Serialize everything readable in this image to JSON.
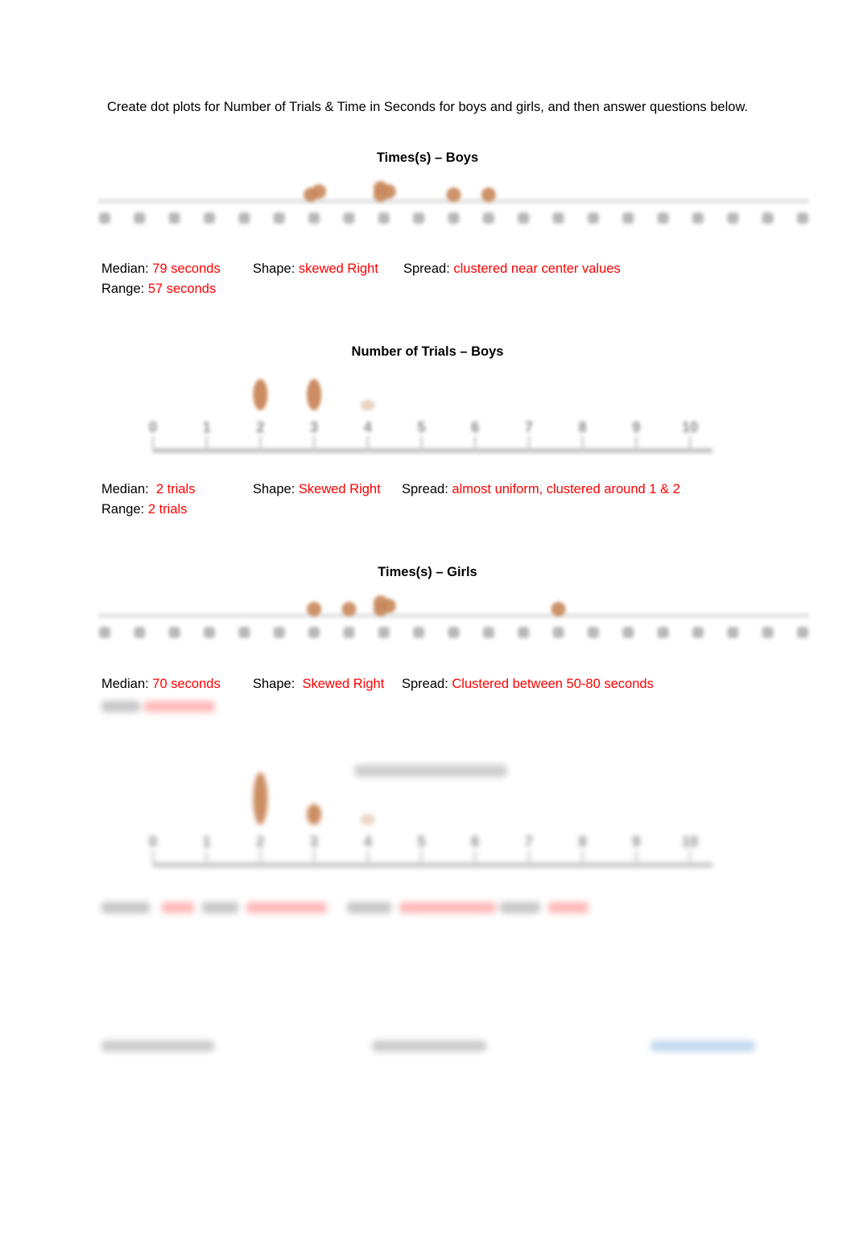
{
  "intro": "Create dot plots for Number of Trials & Time in Seconds for boys and girls, and then answer questions below.",
  "colors": {
    "answer": "#ff0000",
    "dot": "#c8875a",
    "axis": "#bdbdbd"
  },
  "sections": [
    {
      "title": "Times(s) – Boys",
      "median_label": "Median:",
      "median_value": "79 seconds",
      "shape_label": "Shape:",
      "shape_value": "skewed Right",
      "spread_label": "Spread:",
      "spread_value": "clustered near center values",
      "range_label": "Range:",
      "range_value": "57 seconds"
    },
    {
      "title": "Number of Trials – Boys",
      "median_label": "Median:",
      "median_value": "2 trials",
      "shape_label": "Shape:",
      "shape_value": "Skewed Right",
      "spread_label": "Spread:",
      "spread_value": "almost uniform, clustered around 1 & 2",
      "range_label": "Range:",
      "range_value": "2 trials"
    },
    {
      "title": "Times(s) – Girls",
      "median_label": "Median:",
      "median_value": "70 seconds",
      "shape_label": "Shape:",
      "shape_value": "Skewed Right",
      "spread_label": "Spread:",
      "spread_value": "Clustered between 50-80 seconds"
    }
  ],
  "chart_data": [
    {
      "type": "scatter",
      "title": "Times(s) – Boys",
      "tick_count": 21,
      "dot_stacks": [
        {
          "tick_index": 6,
          "count": 2
        },
        {
          "tick_index": 8,
          "count": 3
        },
        {
          "tick_index": 10,
          "count": 1
        },
        {
          "tick_index": 11,
          "count": 1
        }
      ]
    },
    {
      "type": "scatter",
      "title": "Number of Trials – Boys",
      "x": [
        0,
        1,
        2,
        3,
        4,
        5,
        6,
        7,
        8,
        9,
        10
      ],
      "tick_labels": [
        "0",
        "1",
        "2",
        "3",
        "4",
        "5",
        "6",
        "7",
        "8",
        "9",
        "10"
      ],
      "dot_stacks": [
        {
          "x": 2,
          "count": 3
        },
        {
          "x": 3,
          "count": 3
        },
        {
          "x": 4,
          "count": 1
        }
      ]
    },
    {
      "type": "scatter",
      "title": "Times(s) – Girls",
      "tick_count": 21,
      "dot_stacks": [
        {
          "tick_index": 6,
          "count": 1
        },
        {
          "tick_index": 7,
          "count": 1
        },
        {
          "tick_index": 8,
          "count": 3
        },
        {
          "tick_index": 13,
          "count": 1
        }
      ]
    },
    {
      "type": "scatter",
      "title": "Number of Trials – Girls",
      "x": [
        0,
        1,
        2,
        3,
        4,
        5,
        6,
        7,
        8,
        9,
        10
      ],
      "tick_labels": [
        "0",
        "1",
        "2",
        "3",
        "4",
        "5",
        "6",
        "7",
        "8",
        "9",
        "10"
      ],
      "dot_stacks": [
        {
          "x": 2,
          "count": 5
        },
        {
          "x": 3,
          "count": 2
        },
        {
          "x": 4,
          "count": 1
        }
      ]
    }
  ]
}
